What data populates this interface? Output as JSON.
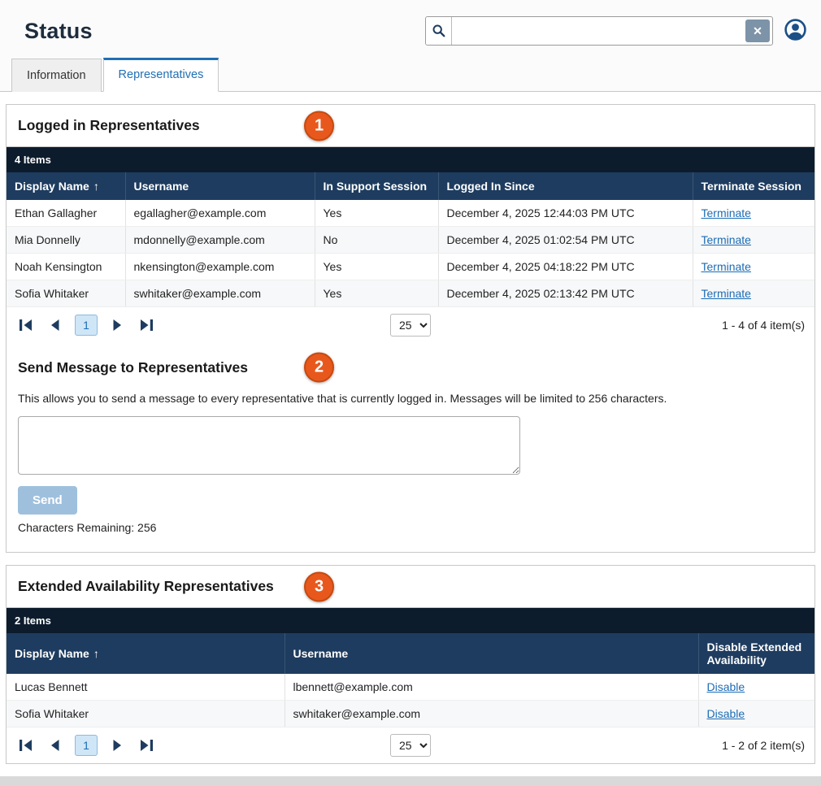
{
  "header": {
    "title": "Status",
    "search": {
      "value": "",
      "placeholder": ""
    }
  },
  "icons": {
    "clear": "✕",
    "sort_arrow": "↑"
  },
  "tabs": [
    {
      "label": "Information",
      "active": false
    },
    {
      "label": "Representatives",
      "active": true
    }
  ],
  "logged_in": {
    "title": "Logged in Representatives",
    "badge": "1",
    "items_count": "4 Items",
    "columns": [
      "Display Name",
      "Username",
      "In Support Session",
      "Logged In Since",
      "Terminate Session"
    ],
    "rows": [
      [
        "Ethan Gallagher",
        "egallagher@example.com",
        "Yes",
        "December 4, 2025 12:44:03 PM UTC",
        "Terminate"
      ],
      [
        "Mia Donnelly",
        "mdonnelly@example.com",
        "No",
        "December 4, 2025 01:02:54 PM UTC",
        "Terminate"
      ],
      [
        "Noah Kensington",
        "nkensington@example.com",
        "Yes",
        "December 4, 2025 04:18:22 PM UTC",
        "Terminate"
      ],
      [
        "Sofia Whitaker",
        "swhitaker@example.com",
        "Yes",
        "December 4, 2025 02:13:42 PM UTC",
        "Terminate"
      ]
    ],
    "pagination": {
      "page": "1",
      "page_size": "25",
      "summary": "1 - 4 of 4 item(s)"
    }
  },
  "send_message": {
    "title": "Send Message to Representatives",
    "badge": "2",
    "description": "This allows you to send a message to every representative that is currently logged in. Messages will be limited to 256 characters.",
    "textarea_value": "",
    "send_label": "Send",
    "chars_remaining": "Characters Remaining: 256"
  },
  "extended": {
    "title": "Extended Availability Representatives",
    "badge": "3",
    "items_count": "2 Items",
    "columns": [
      "Display Name",
      "Username",
      "Disable Extended Availability"
    ],
    "rows": [
      [
        "Lucas Bennett",
        "lbennett@example.com",
        "Disable"
      ],
      [
        "Sofia Whitaker",
        "swhitaker@example.com",
        "Disable"
      ]
    ],
    "pagination": {
      "page": "1",
      "page_size": "25",
      "summary": "1 - 2 of 2 item(s)"
    }
  }
}
